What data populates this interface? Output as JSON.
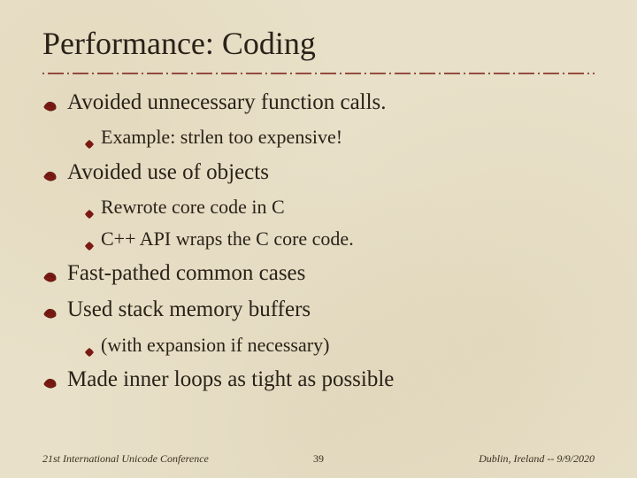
{
  "title": "Performance: Coding",
  "bullets": {
    "b0": "Avoided unnecessary function calls.",
    "b0_0": "Example: strlen too expensive!",
    "b1": "Avoided use of objects",
    "b1_0": "Rewrote core code in C",
    "b1_1": "C++ API wraps the C core code.",
    "b2": "Fast-pathed common cases",
    "b3": "Used stack memory buffers",
    "b3_0": "(with expansion if necessary)",
    "b4": "Made inner loops as tight as possible"
  },
  "footer": {
    "left": "21st International Unicode Conference",
    "center": "39",
    "right": "Dublin, Ireland -- 9/9/2020"
  },
  "colors": {
    "accent": "#7a1a12",
    "text": "#2a2218"
  }
}
